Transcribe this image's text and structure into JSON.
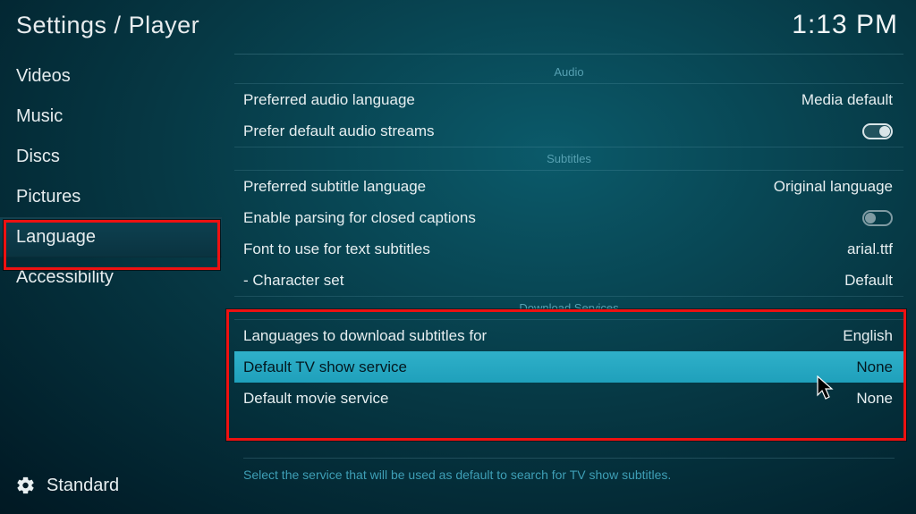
{
  "header": {
    "breadcrumb": "Settings / Player",
    "clock": "1:13 PM"
  },
  "sidebar": {
    "items": [
      {
        "label": "Videos"
      },
      {
        "label": "Music"
      },
      {
        "label": "Discs"
      },
      {
        "label": "Pictures"
      },
      {
        "label": "Language"
      },
      {
        "label": "Accessibility"
      }
    ],
    "selected_index": 4,
    "level_label": "Standard"
  },
  "sections": {
    "audio": {
      "title": "Audio",
      "preferred_audio_language": {
        "label": "Preferred audio language",
        "value": "Media default"
      },
      "prefer_default_streams": {
        "label": "Prefer default audio streams",
        "on": true
      }
    },
    "subtitles": {
      "title": "Subtitles",
      "preferred_subtitle_language": {
        "label": "Preferred subtitle language",
        "value": "Original language"
      },
      "enable_cc": {
        "label": "Enable parsing for closed captions",
        "on": false
      },
      "font": {
        "label": "Font to use for text subtitles",
        "value": "arial.ttf"
      },
      "charset": {
        "label": "- Character set",
        "value": "Default"
      }
    },
    "download": {
      "title": "Download Services",
      "languages": {
        "label": "Languages to download subtitles for",
        "value": "English"
      },
      "tv_service": {
        "label": "Default TV show service",
        "value": "None"
      },
      "movie_service": {
        "label": "Default movie service",
        "value": "None"
      }
    }
  },
  "description": "Select the service that will be used as default to search for TV show subtitles."
}
